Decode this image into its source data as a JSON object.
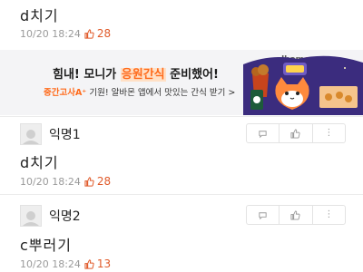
{
  "comments": [
    {
      "text": "d치기",
      "timestamp": "10/20 18:24",
      "likes": "28"
    },
    {
      "user": "익명1",
      "text": "d치기",
      "timestamp": "10/20 18:24",
      "likes": "28"
    },
    {
      "user": "익명2",
      "text": "c뿌러기",
      "timestamp": "10/20 18:24",
      "likes": "13"
    }
  ],
  "ad": {
    "title_prefix": "힘내! 모니가 ",
    "title_highlight": "응원간식",
    "title_suffix": " 준비했어!",
    "sub_accent": "중간고사A⁺",
    "sub_text": " 기원! 알바몬 앱에서 맛있는 간식 받기 >",
    "brand": "albam",
    "brand_o": "o",
    "brand_end": "n"
  },
  "colors": {
    "accent": "#ff6a1a",
    "like": "#e05a2a",
    "meta_gray": "#9a9a9a"
  },
  "icons": [
    "thumbs-up-icon",
    "reply-icon",
    "like-icon",
    "more-icon",
    "avatar-placeholder"
  ]
}
